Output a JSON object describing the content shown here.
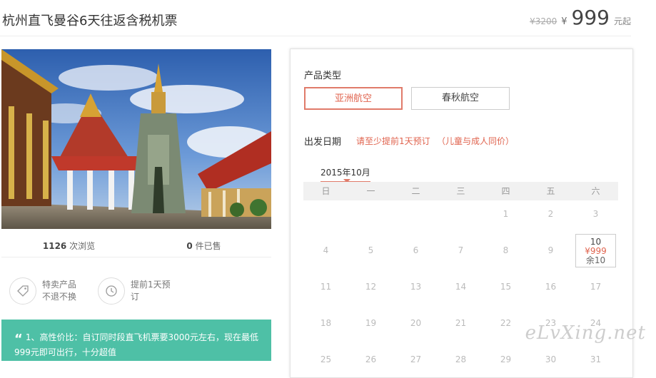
{
  "header": {
    "title": "杭州直飞曼谷6天往返含税机票",
    "old_price": "¥3200",
    "yen": "¥",
    "price": "999",
    "unit": "元起"
  },
  "stats": {
    "views_num": "1126",
    "views_label": "次浏览",
    "sold_num": "0",
    "sold_label": "件已售"
  },
  "features": [
    {
      "icon": "tag-icon",
      "line1": "特卖产品",
      "line2": "不退不换"
    },
    {
      "icon": "clock-icon",
      "line1": "提前1天预",
      "line2": "订"
    }
  ],
  "note": {
    "quote": "“",
    "text": "1、高性价比：自订同时段直飞机票要3000元左右，现在最低999元即可出行，十分超值"
  },
  "booking": {
    "type_label": "产品类型",
    "options": [
      "亚洲航空",
      "春秋航空"
    ],
    "date_label": "出发日期",
    "hint1": "请至少提前1天预订",
    "hint2": "（儿童与成人同价）",
    "month": "2015年10月",
    "weekdays": [
      "日",
      "一",
      "二",
      "三",
      "四",
      "五",
      "六"
    ],
    "days": [
      "1",
      "2",
      "3",
      "4",
      "5",
      "6",
      "7",
      "8",
      "9",
      "10",
      "11",
      "12",
      "13",
      "14",
      "15",
      "16",
      "17",
      "18",
      "19",
      "20",
      "21",
      "22",
      "23",
      "24",
      "25",
      "26",
      "27",
      "28",
      "29",
      "30",
      "31"
    ],
    "first_weekday": 4,
    "selected_day": {
      "day": "10",
      "price": "¥999",
      "remain": "余10"
    }
  },
  "watermark": "eLvXing.net",
  "colors": {
    "accent": "#e0644f",
    "note_bg": "#4ec0a6"
  }
}
